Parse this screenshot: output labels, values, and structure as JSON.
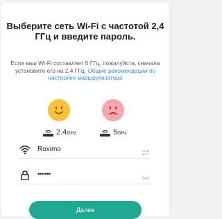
{
  "dialog": {
    "title": "Выберите сеть Wi-Fi с частотой 2,4 ГГц и введите пароль.",
    "description": "Если ваш Wi-Fi составляет 5 ГГц, пожалуйста, сначала установите его на 2,4 ГГц.",
    "recommend_link": "Общие рекомендации по настройке маршрутизатора"
  },
  "bands": {
    "supported": {
      "num": "2.4",
      "unit": "GHz",
      "icon": "router-icon"
    },
    "unsupported": {
      "num": "5",
      "unit": "GHz",
      "icon": "router-icon"
    }
  },
  "ssid_field": {
    "value": "Roximo",
    "icon": "wifi-icon",
    "action_icon": "switch-network-icon"
  },
  "password_field": {
    "value": "•••••••",
    "icon": "lock-icon",
    "action_icon": "eye-closed-icon"
  },
  "next_button": {
    "label": "Далее"
  },
  "colors": {
    "accent": "#1fa892",
    "link": "#2e8ee0",
    "happy_face": "#f9c23a",
    "sad_face": "#f5a7ae"
  }
}
